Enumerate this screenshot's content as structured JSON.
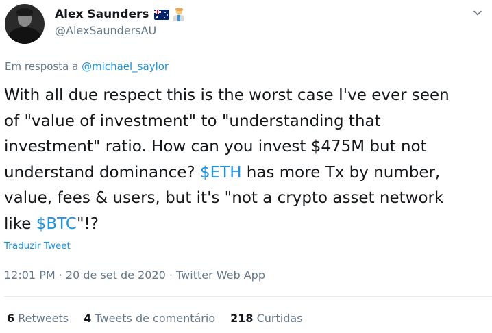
{
  "user": {
    "display_name": "Alex Saunders",
    "handle": "@AlexSaundersAU",
    "badges": [
      "australia-flag-icon",
      "scientist-icon"
    ]
  },
  "reply": {
    "prefix": "Em resposta a ",
    "mention": "@michael_saylor"
  },
  "tweet": {
    "line1": "With all due respect this is the worst case I've ever seen",
    "line2": "of \"value of investment\" to \"understanding that",
    "line3": "investment\" ratio. How can you invest $475M but not",
    "line4_before": "understand dominance? ",
    "line4_cashtag": "$ETH",
    "line4_after": " has more Tx by number,",
    "line5": "value, fees & users, but it's \"not a crypto asset network",
    "line6_before": "like ",
    "line6_cashtag": "$BTC",
    "line6_after": "\"!?"
  },
  "translate_label": "Traduzir Tweet",
  "meta": "12:01 PM · 20 de set de 2020 · Twitter Web App",
  "stats": {
    "retweets_count": "6",
    "retweets_label": "Retweets",
    "comments_count": "4",
    "comments_label": "Tweets de comentário",
    "likes_count": "218",
    "likes_label": "Curtidas"
  },
  "colors": {
    "link": "#1b95e0",
    "secondary_text": "#657786",
    "primary_text": "#14171a",
    "divider": "#e6ecf0"
  }
}
